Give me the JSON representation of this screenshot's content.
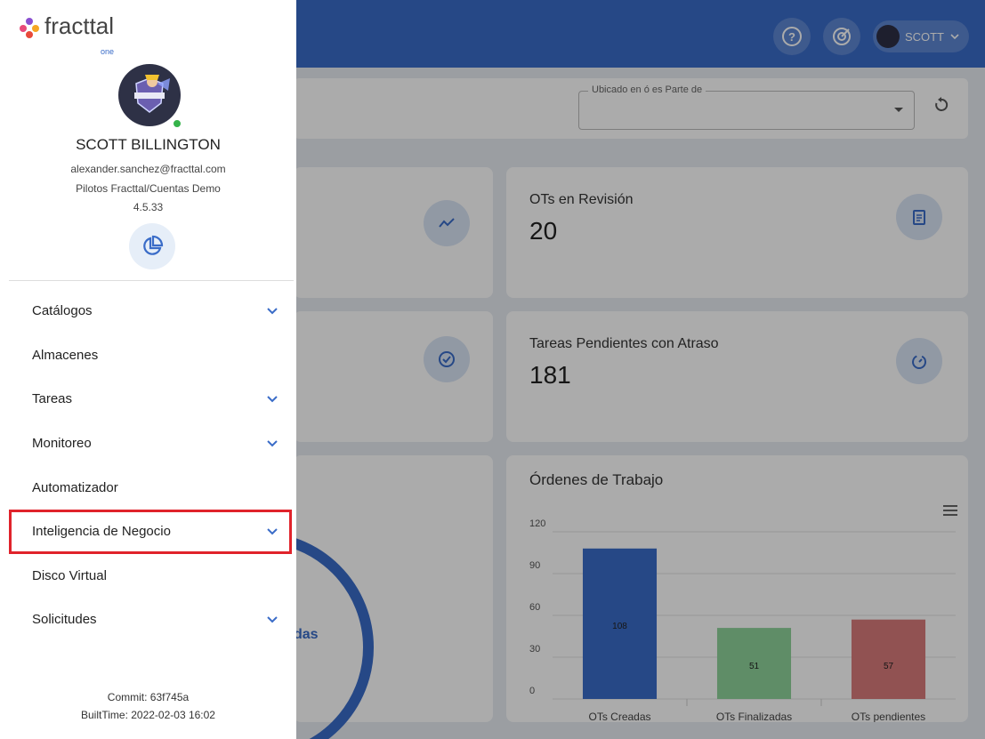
{
  "topbar": {
    "user_label": "SCOTT",
    "accent": "#3a6cc8"
  },
  "filter": {
    "label": "Ubicado en ó es Parte de"
  },
  "cards": {
    "revision": {
      "title": "OTs en Revisión",
      "value": "20",
      "icon": "clipboard-icon"
    },
    "tareas_atraso": {
      "title": "Tareas Pendientes con Atraso",
      "value": "181",
      "icon": "timer-icon"
    }
  },
  "donut": {
    "partial_label": "das"
  },
  "chart": {
    "title": "Órdenes de Trabajo"
  },
  "chart_data": {
    "type": "bar",
    "title": "Órdenes de Trabajo",
    "categories": [
      "OTs Creadas",
      "OTs Finalizadas",
      "OTs pendientes"
    ],
    "values": [
      108,
      51,
      57
    ],
    "colors": [
      "#3a6cc8",
      "#8ed39a",
      "#d87b7b"
    ],
    "yticks": [
      0,
      30,
      60,
      90,
      120
    ],
    "ylim": [
      0,
      120
    ]
  },
  "drawer": {
    "logo_text": "fracttal",
    "logo_sub": "one",
    "user_name": "SCOTT BILLINGTON",
    "email": "alexander.sanchez@fracttal.com",
    "company": "Pilotos Fracttal/Cuentas Demo",
    "version": "4.5.33",
    "menu": [
      {
        "label": "Catálogos",
        "chevron": true
      },
      {
        "label": "Almacenes",
        "chevron": false
      },
      {
        "label": "Tareas",
        "chevron": true
      },
      {
        "label": "Monitoreo",
        "chevron": true
      },
      {
        "label": "Automatizador",
        "chevron": false
      },
      {
        "label": "Inteligencia de Negocio",
        "chevron": true
      },
      {
        "label": "Disco Virtual",
        "chevron": false
      },
      {
        "label": "Solicitudes",
        "chevron": true
      }
    ],
    "commit": "Commit: 63f745a",
    "built_time": "BuiltTime: 2022-02-03 16:02"
  }
}
